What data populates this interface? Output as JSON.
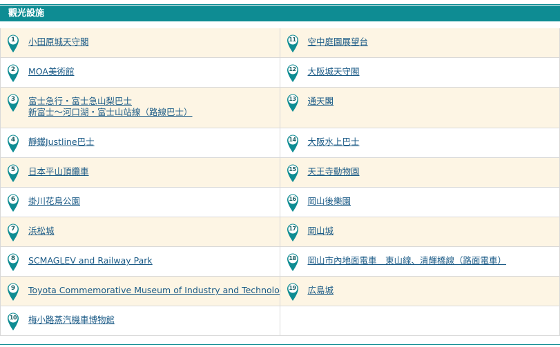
{
  "header": {
    "title": "觀光設施"
  },
  "rows": [
    {
      "h": 43,
      "left": {
        "num": "1",
        "lines": [
          "小田原城天守閣"
        ]
      },
      "right": {
        "num": "11",
        "lines": [
          "空中庭園展望台"
        ]
      }
    },
    {
      "h": 43,
      "left": {
        "num": "2",
        "lines": [
          "MOA美術館"
        ]
      },
      "right": {
        "num": "12",
        "lines": [
          "大阪城天守閣"
        ]
      }
    },
    {
      "h": 59,
      "left": {
        "num": "3",
        "lines": [
          "富士急行・富士急山梨巴士",
          "新富士〜河口湖・富士山站線（路線巴士）"
        ]
      },
      "right": {
        "num": "13",
        "lines": [
          "通天閣"
        ]
      }
    },
    {
      "h": 43,
      "left": {
        "num": "4",
        "lines": [
          "靜鐵Justline巴士"
        ]
      },
      "right": {
        "num": "14",
        "lines": [
          "大阪水上巴士"
        ]
      }
    },
    {
      "h": 43,
      "left": {
        "num": "5",
        "lines": [
          "日本平山頂纜車"
        ]
      },
      "right": {
        "num": "15",
        "lines": [
          "天王寺動物園"
        ]
      }
    },
    {
      "h": 43,
      "left": {
        "num": "6",
        "lines": [
          "掛川花鳥公園"
        ]
      },
      "right": {
        "num": "16",
        "lines": [
          "岡山後樂園"
        ]
      }
    },
    {
      "h": 43,
      "left": {
        "num": "7",
        "lines": [
          "浜松城"
        ]
      },
      "right": {
        "num": "17",
        "lines": [
          "岡山城"
        ]
      }
    },
    {
      "h": 43,
      "left": {
        "num": "8",
        "lines": [
          "SCMAGLEV and Railway Park"
        ]
      },
      "right": {
        "num": "18",
        "lines": [
          "岡山市內地面電車　東山線、清輝橋線（路面電車）"
        ]
      }
    },
    {
      "h": 43,
      "left": {
        "num": "9",
        "lines": [
          "Toyota Commemorative Museum of Industry and Technology"
        ]
      },
      "right": {
        "num": "19",
        "lines": [
          "広島城"
        ]
      }
    },
    {
      "h": 43,
      "left": {
        "num": "10",
        "lines": [
          "梅小路蒸汽機車博物館"
        ]
      },
      "right": null
    }
  ],
  "colors": {
    "header_bg": "#0e8c93",
    "alt_row_bg": "#fdf5e4",
    "link": "#1a5a86",
    "pin": "#0e8c93"
  }
}
